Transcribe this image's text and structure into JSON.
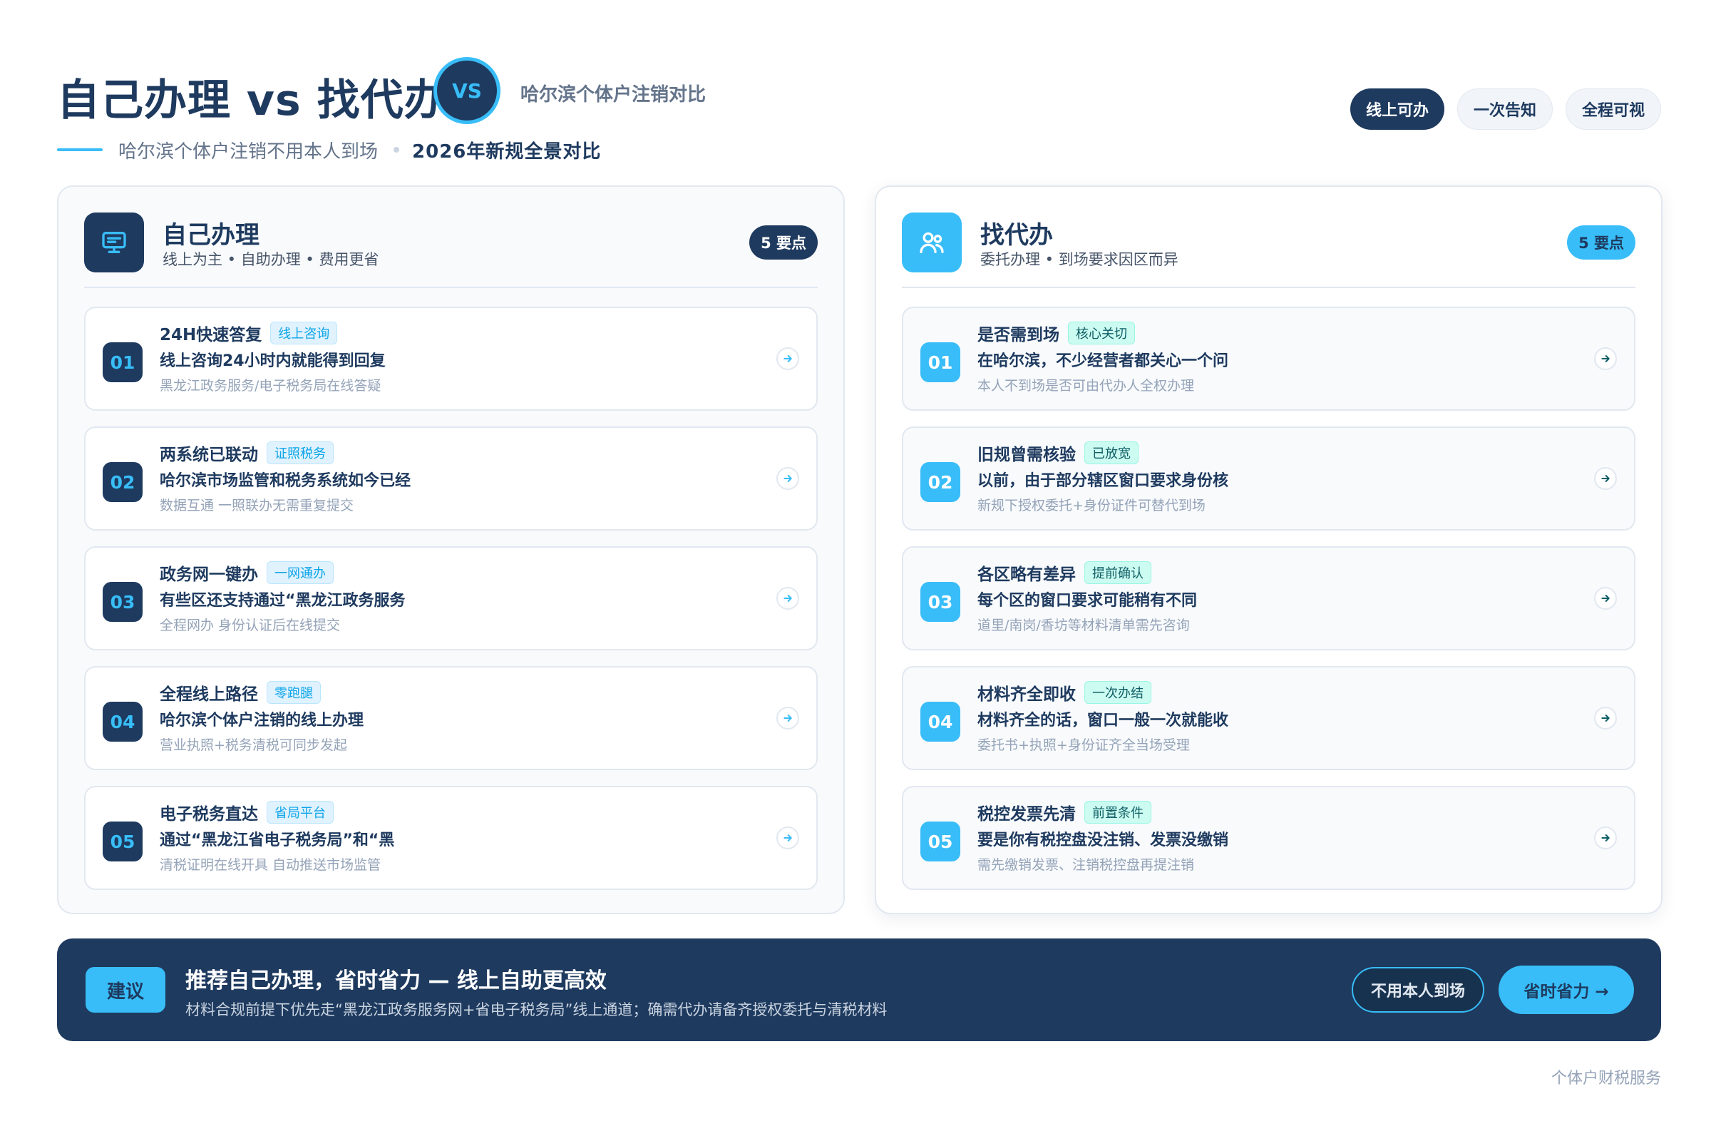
{
  "header": {
    "title": "自己办理 vs 找代办",
    "vs_label": "VS",
    "subtitle": "哈尔滨个体户注销对比",
    "subline_text": "哈尔滨个体户注销不用本人到场",
    "subline_bold": "2026年新规全景对比",
    "pills": [
      "线上可办",
      "一次告知",
      "全程可视"
    ]
  },
  "left_panel": {
    "title": "自己办理",
    "subtitle": "线上为主 • 自助办理 • 费用更省",
    "badge": "5 要点",
    "items": [
      {
        "num": "01",
        "title": "24H快速答复",
        "tag": "线上咨询",
        "desc": "线上咨询24小时内就能得到回复",
        "note": "黑龙江政务服务/电子税务局在线答疑"
      },
      {
        "num": "02",
        "title": "两系统已联动",
        "tag": "证照税务",
        "desc": "哈尔滨市场监管和税务系统如今已经",
        "note": "数据互通 一照联办无需重复提交"
      },
      {
        "num": "03",
        "title": "政务网一键办",
        "tag": "一网通办",
        "desc": "有些区还支持通过“黑龙江政务服务",
        "note": "全程网办 身份认证后在线提交"
      },
      {
        "num": "04",
        "title": "全程线上路径",
        "tag": "零跑腿",
        "desc": "哈尔滨个体户注销的线上办理",
        "note": "营业执照+税务清税可同步发起"
      },
      {
        "num": "05",
        "title": "电子税务直达",
        "tag": "省局平台",
        "desc": "通过“黑龙江省电子税务局”和“黑",
        "note": "清税证明在线开具 自动推送市场监管"
      }
    ]
  },
  "right_panel": {
    "title": "找代办",
    "subtitle": "委托办理 • 到场要求因区而异",
    "badge": "5 要点",
    "items": [
      {
        "num": "01",
        "title": "是否需到场",
        "tag": "核心关切",
        "desc": "在哈尔滨，不少经营者都关心一个问",
        "note": "本人不到场是否可由代办人全权办理"
      },
      {
        "num": "02",
        "title": "旧规曾需核验",
        "tag": "已放宽",
        "desc": "以前，由于部分辖区窗口要求身份核",
        "note": "新规下授权委托+身份证件可替代到场"
      },
      {
        "num": "03",
        "title": "各区略有差异",
        "tag": "提前确认",
        "desc": "每个区的窗口要求可能稍有不同",
        "note": "道里/南岗/香坊等材料清单需先咨询"
      },
      {
        "num": "04",
        "title": "材料齐全即收",
        "tag": "一次办结",
        "desc": "材料齐全的话，窗口一般一次就能收",
        "note": "委托书+执照+身份证齐全当场受理"
      },
      {
        "num": "05",
        "title": "税控发票先清",
        "tag": "前置条件",
        "desc": "要是你有税控盘没注销、发票没缴销",
        "note": "需先缴销发票、注销税控盘再提注销"
      }
    ]
  },
  "banner": {
    "tag": "建议",
    "title": "推荐自己办理，省时省力 — 线上自助更高效",
    "subtitle": "材料合规前提下优先走“黑龙江政务服务网+省电子税务局”线上通道；确需代办请备齐授权委托与清税材料",
    "btn_outline": "不用本人到场",
    "btn_primary": "省时省力 →"
  },
  "footer": "个体户财税服务",
  "colors": {
    "navy": "#1e3a5f",
    "accent": "#38bdf8"
  }
}
